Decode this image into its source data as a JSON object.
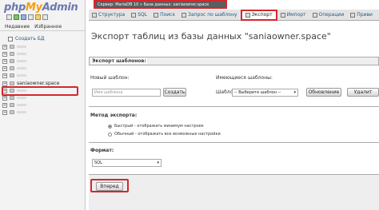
{
  "sidebar": {
    "logo": {
      "php": "php",
      "my": "My",
      "admin": "Admin"
    },
    "tabs": [
      "Недавние",
      "Избранное"
    ],
    "create_db": "Создать БД",
    "selected_db": "saniaowner.space"
  },
  "breadcrumb": {
    "text": "Сервер: MariaDB 10 » База данных: saniaowner.space"
  },
  "tabs": [
    {
      "label": "Структура"
    },
    {
      "label": "SQL"
    },
    {
      "label": "Поиск"
    },
    {
      "label": "Запрос по шаблону"
    },
    {
      "label": "Экспорт"
    },
    {
      "label": "Импорт"
    },
    {
      "label": "Операции"
    },
    {
      "label": "Приви"
    }
  ],
  "main": {
    "title": "Экспорт таблиц из базы данных \"saniaowner.space\"",
    "templates": {
      "legend": "Экспорт шаблонов:",
      "new_label": "Новый шаблон:",
      "new_placeholder": "Имя шаблона",
      "create_button": "Создать",
      "existing_label": "Имеющиеся шаблоны:",
      "template_label": "Шаблон:",
      "select_value": "-- Выберите шаблон --",
      "update_button": "Обновление",
      "delete_button": "Удалит"
    },
    "method": {
      "title": "Метод экспорта:",
      "quick": "Быстрый - отображать минимум настроек",
      "custom": "Обычный - отображать все возможные настройки"
    },
    "format": {
      "title": "Формат:",
      "value": "SQL"
    },
    "submit_button": "Вперед"
  }
}
